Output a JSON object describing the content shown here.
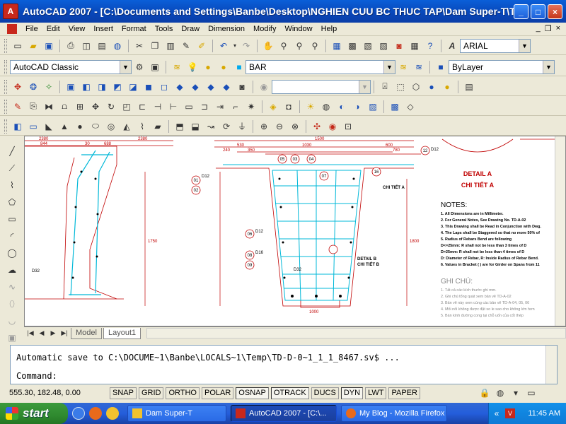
{
  "window": {
    "title": "AutoCAD 2007 - [C:\\Documents and Settings\\Banbe\\Desktop\\NGHIEN CUU BC THUC TAP\\Dam Super-T\\TD-D-0-...",
    "logo": "A",
    "minimize": "_",
    "maximize": "□",
    "close": "×"
  },
  "menu": {
    "items": [
      "File",
      "Edit",
      "View",
      "Insert",
      "Format",
      "Tools",
      "Draw",
      "Dimension",
      "Modify",
      "Window",
      "Help"
    ],
    "mdi": [
      "_",
      "❐",
      "×"
    ]
  },
  "toolbar": {
    "font_combo": "ARIAL",
    "workspace_combo": "AutoCAD Classic",
    "layer_combo": "BAR",
    "color_combo": "ByLayer"
  },
  "drawing": {
    "labels": {
      "detail_a": "DETAIL A",
      "chi_tiet_a": "CHI TIẾT A",
      "detail_b": "DETAIL B",
      "chi_tiet_b": "CHI TIẾT B",
      "notes_title": "NOTES:",
      "ghi_chu_title": "GHI CHÚ:",
      "notes": [
        "1. All Dimensions are in Millimeter.",
        "2. For General Notes, See Drawing No. TD-A-02",
        "3. This Drawing shall be Read in Conjunction with Dwg.",
        "4. The Laps shall be Staggered so that no more 50% of",
        "5. Radius of Rebars Bend are following",
        "D<=25mm: R shall not be less than 3 times of D",
        "D>25mm: R shall not be less than 4 times of D",
        "D: Diameter of Rebar, R: Inside Radius of Rebar Bend.",
        "6. Values in Bracket ( ) are for Girder on Spans from 11"
      ],
      "ghi_chu": [
        "1. Tất cả các kích thước ghi mm.",
        "2. Ghi chú tổng quát xem bản vẽ TD-A-02",
        "3. Bản vẽ này xem cùng các bản vẽ TD-A-04, 05, 06",
        "4. Mối nối không được đặt so le sao cho không lớn hơn",
        "5. Bán kính đường cong tại chỗ uốn của cốt thép"
      ],
      "rebar_tags": [
        "01",
        "02",
        "03",
        "04",
        "05",
        "06",
        "07",
        "08",
        "09",
        "12",
        "16"
      ],
      "rebar_sizes": [
        "D32",
        "D12",
        "D16",
        "D32"
      ],
      "dims": [
        "2380",
        "844",
        "30",
        "688",
        "530",
        "1030",
        "350",
        "1500",
        "1800",
        "1750",
        "600",
        "2380",
        "1000",
        "780",
        "240"
      ]
    }
  },
  "tabs": {
    "model": "Model",
    "layout1": "Layout1"
  },
  "command": {
    "history": "Automatic save to C:\\DOCUME~1\\Banbe\\LOCALS~1\\Temp\\TD-D-0~1_1_1_8467.sv$ ...",
    "prompt": "Command:"
  },
  "status": {
    "coords": "555.30, 182.48, 0.00",
    "buttons": [
      "SNAP",
      "GRID",
      "ORTHO",
      "POLAR",
      "OSNAP",
      "OTRACK",
      "DUCS",
      "DYN",
      "LWT",
      "PAPER"
    ]
  },
  "taskbar": {
    "start": "start",
    "tasks": [
      "Dam Super-T",
      "AutoCAD 2007 - [C:\\...",
      "My Blog - Mozilla Firefox"
    ],
    "clock": "11:45 AM"
  }
}
